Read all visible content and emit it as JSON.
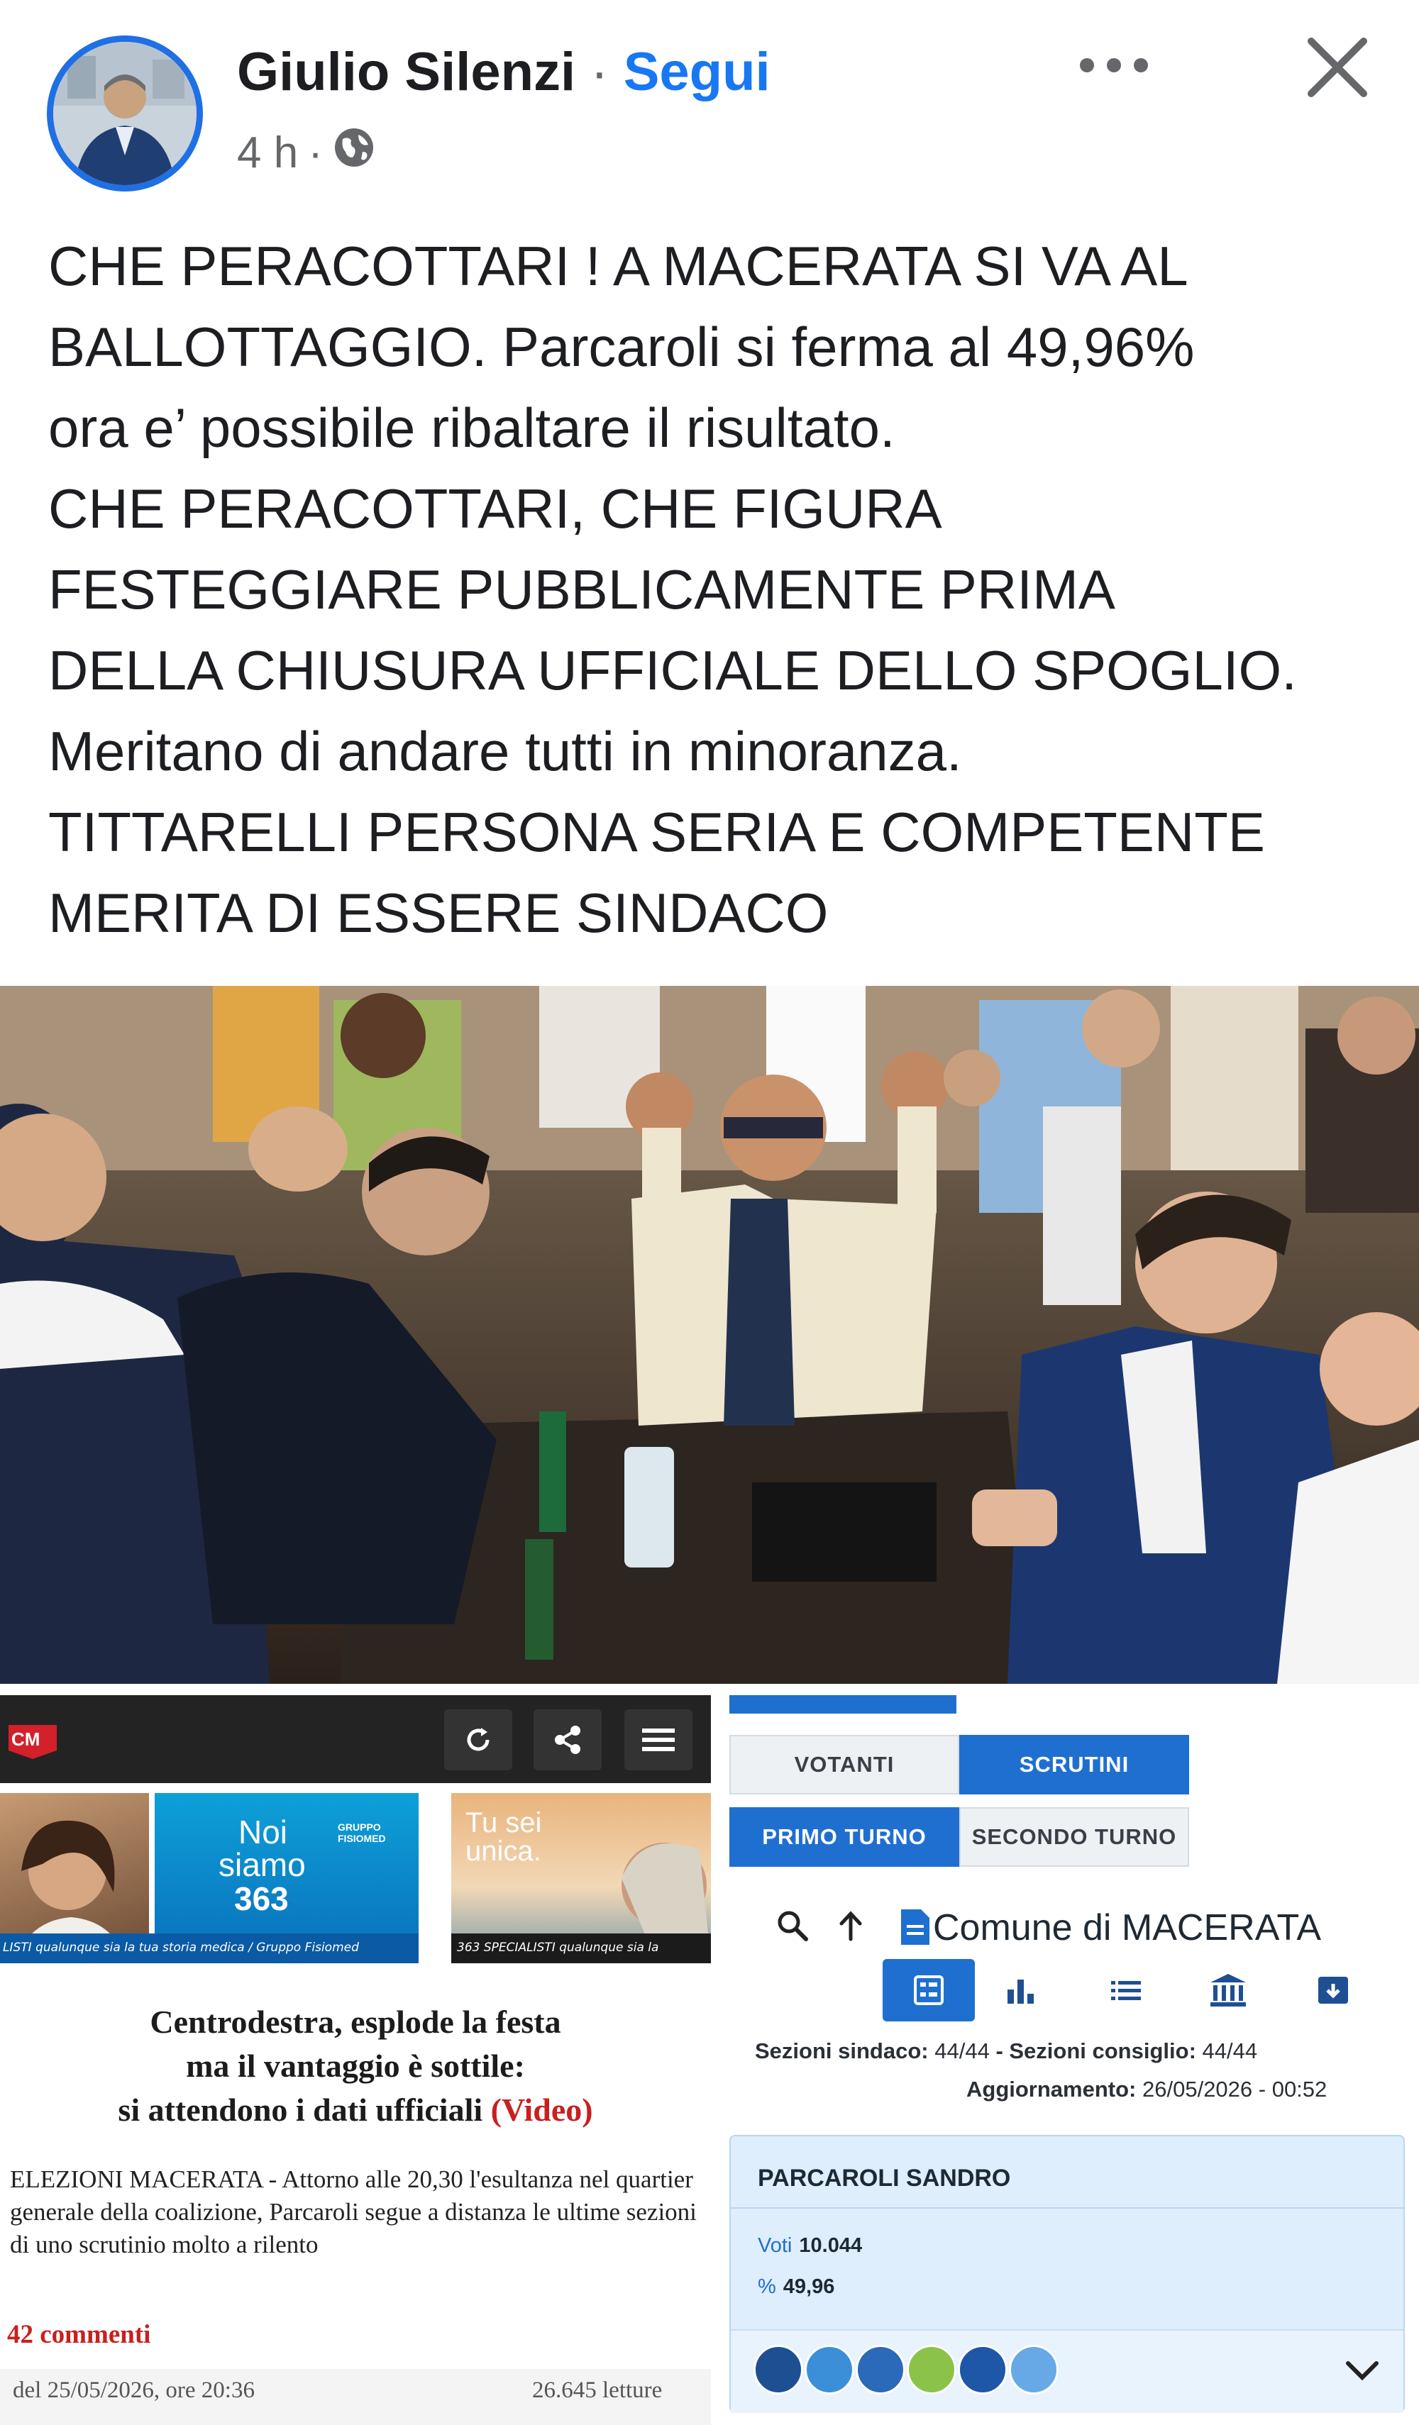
{
  "post": {
    "author": "Giulio Silenzi",
    "separator": "·",
    "follow_label": "Segui",
    "time": "4 h",
    "time_sep": "·",
    "text_lines": [
      "CHE PERACOTTARI ! A MACERATA SI VA AL",
      "BALLOTTAGGIO. Parcaroli si ferma al 49,96%",
      "ora e’ possibile ribaltare il risultato.",
      "CHE PERACOTTARI, CHE FIGURA",
      "FESTEGGIARE PUBBLICAMENTE PRIMA",
      "DELLA CHIUSURA UFFICIALE DELLO SPOGLIO.",
      "Meritano di andare tutti in minoranza.",
      "TITTARELLI PERSONA SERIA E COMPETENTE",
      "MERITA DI ESSERE SINDACO"
    ],
    "privacy_icon": "globe-icon",
    "accent": "#1877f2"
  },
  "news": {
    "logo": "CM",
    "ads": {
      "noi": "Noi",
      "siamo": "siamo",
      "num": "363",
      "brand": "GRUPPO FISIOMED",
      "tu_sei": "Tu sei",
      "unica": "unica.",
      "strip1": "LISTI qualunque sia la tua storia medica / Gruppo Fisiomed",
      "strip2": "363 SPECIALISTI qualunque sia la"
    },
    "headline": [
      "Centrodestra, esplode la festa",
      "ma il vantaggio è sottile:",
      "si attendono i dati ufficiali"
    ],
    "headline_video": "(Video)",
    "lead": "ELEZIONI MACERATA - Attorno alle 20,30 l'esultanza nel quartier generale della coalizione, Parcaroli segue a distanza le ultime sezioni di uno scrutinio molto a rilento",
    "comments": "42 commenti",
    "date": "del 25/05/2026, ore 20:36",
    "reads": "26.645 letture"
  },
  "elections": {
    "tab_votanti": "VOTANTI",
    "tab_scrutini": "SCRUTINI",
    "tab_primo": "PRIMO TURNO",
    "tab_secondo": "SECONDO TURNO",
    "comune": "Comune di MACERATA",
    "sezioni_sindaco_label": "Sezioni sindaco:",
    "sezioni_sindaco": "44/44",
    "sezioni_consiglio_label": "- Sezioni consiglio:",
    "sezioni_consiglio": "44/44",
    "aggiornamento_label": "Aggiornamento:",
    "aggiornamento": "26/05/2026 - 00:52",
    "candidate": "PARCAROLI SANDRO",
    "voti_label": "Voti",
    "voti": "10.044",
    "pct_label": "%",
    "pct": "49,96",
    "accent": "#1f6fd1"
  }
}
